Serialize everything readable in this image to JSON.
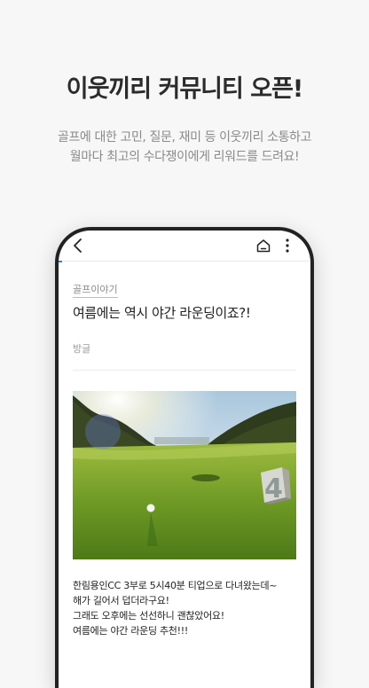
{
  "hero": {
    "title": "이웃끼리 커뮤니티 오픈!",
    "subtitle_line1": "골프에 대한 고민, 질문, 재미 등 이웃끼리 소통하고",
    "subtitle_line2": "월마다 최고의 수다쟁이에게 리워드를 드려요!"
  },
  "app_bar": {
    "back_icon": "chevron-left-icon",
    "home_icon": "home-icon",
    "more_icon": "more-vertical-icon"
  },
  "post": {
    "category": "골프이야기",
    "title": "여름에는 역시 야간 라운딩이죠?!",
    "author": "방글",
    "image": "golf-course-photo",
    "body": [
      "한림용인CC 3부로 5시40분 티업으로 다녀왔는데~",
      "해가 길어서 덥더라구요!",
      "그래도 오후에는 선선하니 괜찮았어요!",
      "여름에는 야간 라운딩 추천!!!"
    ],
    "tee_marker": "4"
  },
  "colors": {
    "accent": "#2c7be5",
    "background": "#f7f7f7",
    "phone_frame": "#222222"
  }
}
